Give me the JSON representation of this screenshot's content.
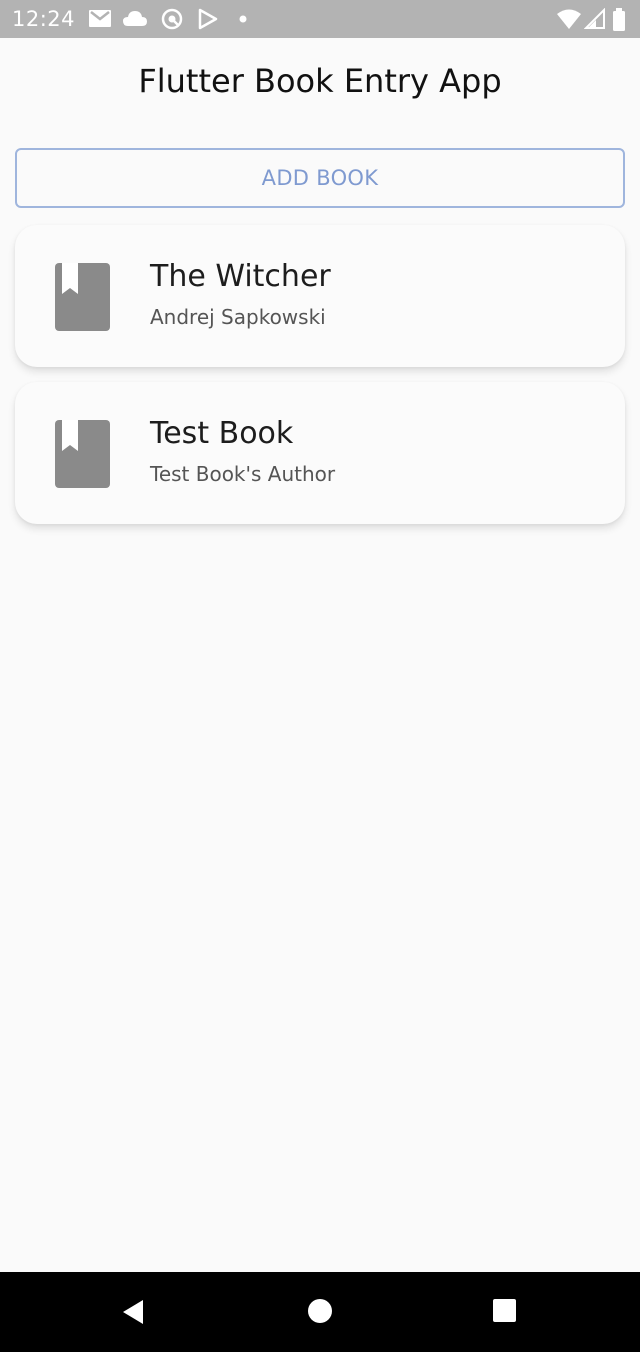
{
  "status_bar": {
    "time": "12:24",
    "icons": [
      "gmail-icon",
      "cloud-icon",
      "at-sign-icon",
      "play-store-icon",
      "dot-icon",
      "wifi-icon",
      "cell-signal-icon",
      "battery-icon"
    ]
  },
  "app": {
    "title": "Flutter Book Entry App"
  },
  "actions": {
    "add_book_label": "ADD BOOK"
  },
  "books": [
    {
      "title": "The Witcher",
      "author": "Andrej Sapkowski",
      "icon": "bookmark-book-icon"
    },
    {
      "title": "Test Book",
      "author": "Test Book's Author",
      "icon": "bookmark-book-icon"
    }
  ],
  "nav_bar": {
    "buttons": [
      "back-icon",
      "home-icon",
      "recents-icon"
    ]
  },
  "colors": {
    "status_bar": "#b3b3b3",
    "accent": "#7f9ad0",
    "icon_gray": "#8a8a8a",
    "nav_bar": "#000000"
  }
}
